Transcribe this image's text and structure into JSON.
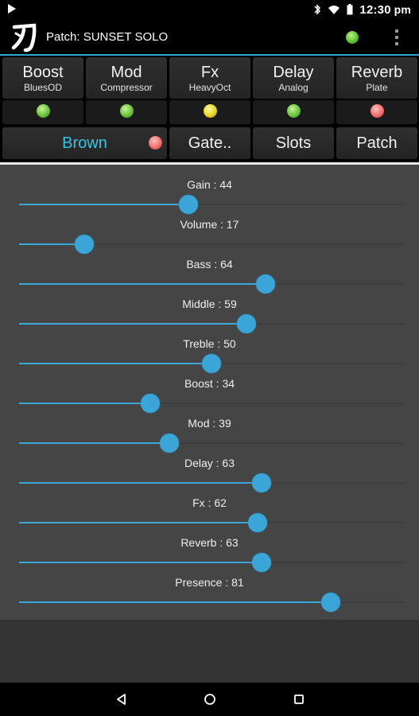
{
  "status_bar": {
    "time": "12:30",
    "period": "pm",
    "icons": [
      "play-store-icon",
      "bluetooth-icon",
      "wifi-icon",
      "battery-icon"
    ]
  },
  "app_bar": {
    "logo_icon": "katana-logo-icon",
    "patch_prefix": "Patch:",
    "patch_name": "SUNSET SOLO",
    "status_color": "#5fc033"
  },
  "effects": [
    {
      "title": "Boost",
      "subtitle": "BluesOD",
      "led": "green"
    },
    {
      "title": "Mod",
      "subtitle": "Compressor",
      "led": "green"
    },
    {
      "title": "Fx",
      "subtitle": "HeavyOct",
      "led": "yellow"
    },
    {
      "title": "Delay",
      "subtitle": "Analog",
      "led": "green"
    },
    {
      "title": "Reverb",
      "subtitle": "Plate",
      "led": "red"
    }
  ],
  "actions": {
    "amp_label": "Brown",
    "gate_label": "Gate..",
    "slots_label": "Slots",
    "patch_label": "Patch"
  },
  "sliders": [
    {
      "label": "Gain : 44",
      "value": 44
    },
    {
      "label": "Volume : 17",
      "value": 17
    },
    {
      "label": "Bass : 64",
      "value": 64
    },
    {
      "label": "Middle : 59",
      "value": 59
    },
    {
      "label": "Treble : 50",
      "value": 50
    },
    {
      "label": "Boost : 34",
      "value": 34
    },
    {
      "label": "Mod : 39",
      "value": 39
    },
    {
      "label": "Delay : 63",
      "value": 63
    },
    {
      "label": "Fx : 62",
      "value": 62
    },
    {
      "label": "Reverb : 63",
      "value": 63
    },
    {
      "label": "Presence : 81",
      "value": 81
    }
  ],
  "colors": {
    "accent": "#3aa5d6",
    "amp_text": "#35c4e6",
    "led_green": "#6cc23b",
    "led_yellow": "#e8d425",
    "led_red": "#f06e6e"
  },
  "nav": [
    "back-icon",
    "home-icon",
    "recents-icon"
  ]
}
